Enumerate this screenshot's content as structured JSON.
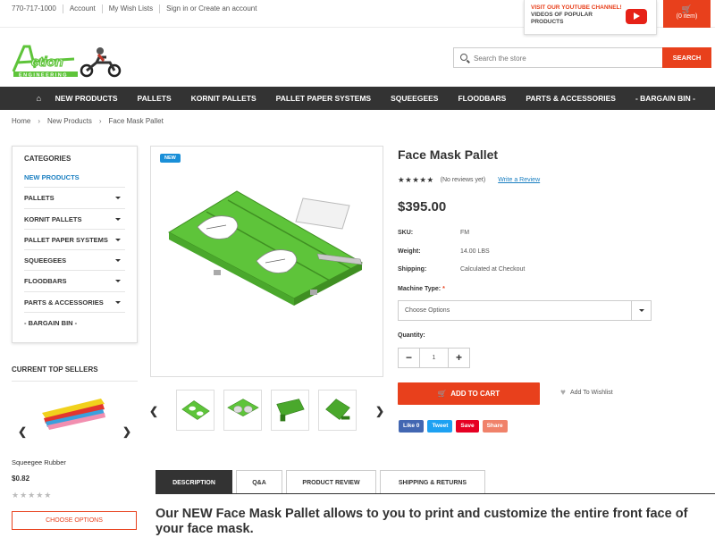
{
  "header": {
    "phone": "770-717-1000",
    "links": [
      "Account",
      "My Wish Lists",
      "Sign in or Create an account"
    ],
    "youtube_line1": "VISIT OUR YOUTUBE CHANNEL!",
    "youtube_line2": "VIDEOS OF POPULAR PRODUCTS",
    "cart_label": "(0 item)"
  },
  "logo": {
    "name": "Action",
    "sub": "ENGINEERING"
  },
  "search": {
    "placeholder": "Search the store",
    "button": "SEARCH"
  },
  "nav": [
    "NEW PRODUCTS",
    "PALLETS",
    "KORNIT PALLETS",
    "PALLET PAPER SYSTEMS",
    "SQUEEGEES",
    "FLOODBARS",
    "PARTS & ACCESSORIES",
    "- BARGAIN BIN -"
  ],
  "breadcrumb": [
    "Home",
    "New Products",
    "Face Mask Pallet"
  ],
  "categories": {
    "heading": "CATEGORIES",
    "items": [
      "NEW PRODUCTS",
      "PALLETS",
      "KORNIT PALLETS",
      "PALLET PAPER SYSTEMS",
      "SQUEEGEES",
      "FLOODBARS",
      "PARTS & ACCESSORIES",
      "- BARGAIN BIN -"
    ]
  },
  "top_sellers": {
    "heading": "CURRENT TOP SELLERS",
    "name": "Squeegee Rubber",
    "price": "$0.82",
    "button": "CHOOSE OPTIONS"
  },
  "product": {
    "badge": "NEW",
    "title": "Face Mask Pallet",
    "reviews": "(No reviews yet)",
    "write_review": "Write a Review",
    "price": "$395.00",
    "sku_label": "SKU:",
    "sku": "FM",
    "weight_label": "Weight:",
    "weight": "14.00 LBS",
    "shipping_label": "Shipping:",
    "shipping": "Calculated at Checkout",
    "machine_label": "Machine Type:",
    "required_mark": "*",
    "machine_placeholder": "Choose Options",
    "quantity_label": "Quantity:",
    "quantity": "1",
    "add_to_cart": "ADD TO CART",
    "wishlist": "Add To Wishlist"
  },
  "social": {
    "like": "Like 0",
    "tweet": "Tweet",
    "save": "Save",
    "share": "Share"
  },
  "tabs": [
    "DESCRIPTION",
    "Q&A",
    "PRODUCT REVIEW",
    "SHIPPING & RETURNS"
  ],
  "description": "Our NEW Face Mask Pallet allows to you to print and customize the entire front face of your face mask.",
  "colors": {
    "accent": "#e8401c",
    "nav_bg": "#333333",
    "link": "#1a7fc1",
    "product_green": "#5ec43a"
  }
}
